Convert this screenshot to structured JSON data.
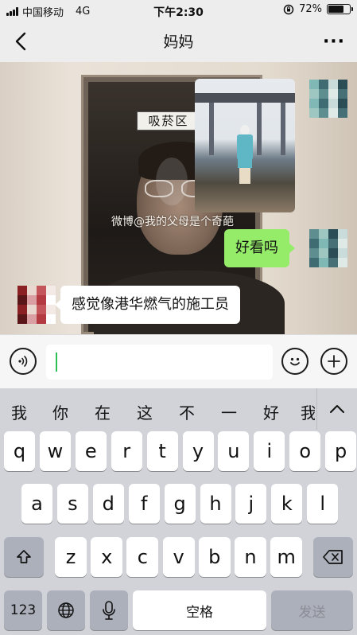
{
  "status_bar": {
    "carrier": "中国移动",
    "network": "4G",
    "time": "下午2:30",
    "battery": "72%",
    "battery_level": 0.72,
    "icons": [
      "signal-icon",
      "orientation-lock-icon",
      "battery-icon"
    ]
  },
  "nav": {
    "title": "妈妈",
    "back_icon": "chevron-left-icon",
    "more_label": "···"
  },
  "chat": {
    "background_sign_text": "吸菸区",
    "watermark": "微博@我的父母是个奇葩",
    "messages": [
      {
        "from": "me",
        "type": "image",
        "image_desc": "photo-of-person-by-sea"
      },
      {
        "from": "me",
        "type": "text",
        "text": "好看吗"
      },
      {
        "from": "mom",
        "type": "text",
        "text": "感觉像港华燃气的施工员"
      }
    ],
    "colors": {
      "sent_bubble": "#95ec69",
      "received_bubble": "#ffffff"
    }
  },
  "input_bar": {
    "value": "",
    "placeholder": "",
    "caret_color": "#2dbe54",
    "icons": [
      "voice-icon",
      "emoji-icon",
      "plus-icon"
    ]
  },
  "keyboard": {
    "suggestions": [
      "我",
      "你",
      "在",
      "这",
      "不",
      "一",
      "好",
      "我"
    ],
    "row1": [
      "q",
      "w",
      "e",
      "r",
      "t",
      "y",
      "u",
      "i",
      "o",
      "p"
    ],
    "row2": [
      "a",
      "s",
      "d",
      "f",
      "g",
      "h",
      "j",
      "k",
      "l"
    ],
    "row3": [
      "z",
      "x",
      "c",
      "v",
      "b",
      "n",
      "m"
    ],
    "num_key": "123",
    "space_key": "空格",
    "send_key": "发送",
    "icons": [
      "shift-icon",
      "backspace-icon",
      "globe-icon",
      "microphone-icon",
      "collapse-chevron-icon"
    ]
  }
}
